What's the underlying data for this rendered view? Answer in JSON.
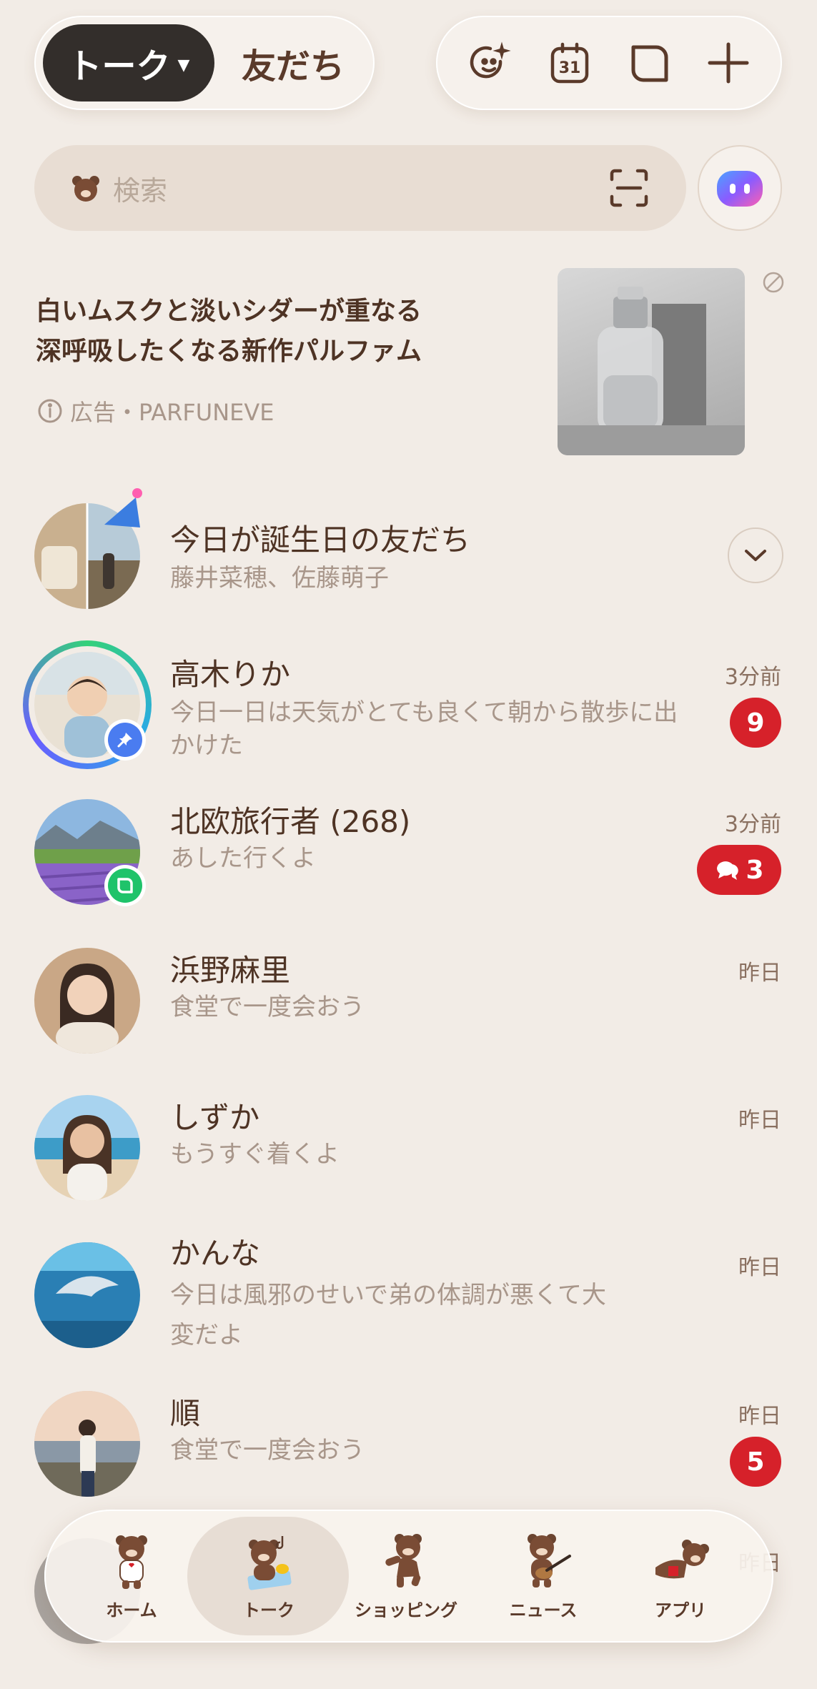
{
  "header": {
    "tab_active": "トーク",
    "tab_other": "友だち",
    "tools": [
      "sticker-sparkle-icon",
      "calendar-icon",
      "chat-bubble-icon",
      "plus-icon"
    ],
    "calendar_day": "31"
  },
  "search": {
    "placeholder": "検索"
  },
  "ad": {
    "title_line1": "白いムスクと淡いシダーが重なる",
    "title_line2": "深呼吸したくなる新作パルファム",
    "meta": "広告・PARFUNEVE"
  },
  "chats": [
    {
      "name": "今日が誕生日の友だち",
      "preview": "藤井菜穂、佐藤萌子",
      "time": "",
      "badge": ""
    },
    {
      "name": "高木りか",
      "preview": "今日一日は天気がとても良くて朝から散歩に出かけた",
      "time": "3分前",
      "badge": "9"
    },
    {
      "name": "北欧旅行者 (268)",
      "preview": "あした行くよ",
      "time": "3分前",
      "badge": "3"
    },
    {
      "name": "浜野麻里",
      "preview": "食堂で一度会おう",
      "time": "昨日",
      "badge": ""
    },
    {
      "name": "しずか",
      "preview": "もうすぐ着くよ",
      "time": "昨日",
      "badge": ""
    },
    {
      "name": "かんな",
      "preview": "今日は風邪のせいで弟の体調が悪くて大変だよ",
      "time": "昨日",
      "badge": ""
    },
    {
      "name": "順",
      "preview": "食堂で一度会おう",
      "time": "昨日",
      "badge": "5"
    },
    {
      "name": "",
      "preview": "",
      "time": "昨日",
      "badge": ""
    }
  ],
  "bottom_nav": {
    "items": [
      {
        "label": "ホーム",
        "icon": "bear-home-icon"
      },
      {
        "label": "トーク",
        "icon": "bear-talk-icon"
      },
      {
        "label": "ショッピング",
        "icon": "bear-shopping-icon"
      },
      {
        "label": "ニュース",
        "icon": "bear-news-icon"
      },
      {
        "label": "アプリ",
        "icon": "bear-apps-icon"
      }
    ],
    "active": "トーク"
  },
  "colors": {
    "background": "#f2ece6",
    "badge_red": "#d6212a",
    "active_tab": "#332e2b"
  }
}
